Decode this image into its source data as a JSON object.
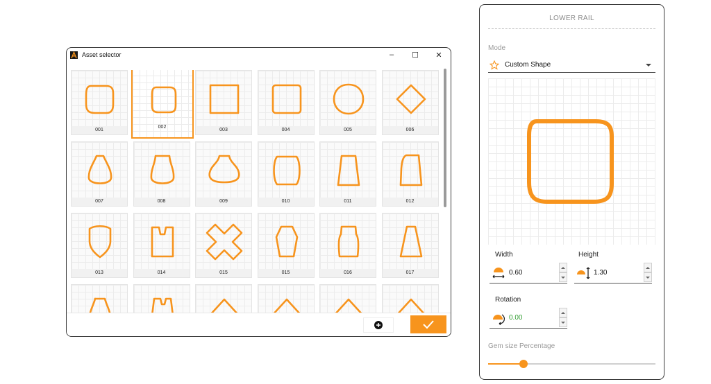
{
  "colors": {
    "accent": "#f7941d",
    "value_green": "#2e9b2e"
  },
  "asset_selector": {
    "title": "Asset selector",
    "window_controls": {
      "minimize": "–",
      "maximize": "☐",
      "close": "✕"
    },
    "selected_index": 1,
    "assets": [
      {
        "label": "001",
        "shape": "rounded-square-soft"
      },
      {
        "label": "002",
        "shape": "rounded-square"
      },
      {
        "label": "003",
        "shape": "square"
      },
      {
        "label": "004",
        "shape": "square-rounded-corners"
      },
      {
        "label": "005",
        "shape": "cushion-round"
      },
      {
        "label": "006",
        "shape": "diamond"
      },
      {
        "label": "007",
        "shape": "pear"
      },
      {
        "label": "008",
        "shape": "pear-flat-top"
      },
      {
        "label": "009",
        "shape": "bell"
      },
      {
        "label": "010",
        "shape": "barrel"
      },
      {
        "label": "011",
        "shape": "trapezoid"
      },
      {
        "label": "012",
        "shape": "tall-trapezoid-curved"
      },
      {
        "label": "013",
        "shape": "shield"
      },
      {
        "label": "014",
        "shape": "notched-rectangle"
      },
      {
        "label": "015",
        "shape": "cross"
      },
      {
        "label": "015",
        "shape": "hexagon-tall"
      },
      {
        "label": "016",
        "shape": "vase"
      },
      {
        "label": "017",
        "shape": "tall-trapezoid"
      },
      {
        "label": "",
        "shape": "partial-arch"
      },
      {
        "label": "",
        "shape": "partial-notch"
      },
      {
        "label": "",
        "shape": "partial-chevron"
      },
      {
        "label": "",
        "shape": "partial-chevron"
      },
      {
        "label": "",
        "shape": "partial-chevron"
      },
      {
        "label": "",
        "shape": "partial-chevron"
      }
    ],
    "footer": {
      "add_icon": "plus-circle-icon",
      "confirm_icon": "check-icon"
    }
  },
  "lower_rail": {
    "title": "LOWER RAIL",
    "mode_label": "Mode",
    "mode_value": "Custom Shape",
    "width_label": "Width",
    "width_value": "0.60",
    "height_label": "Height",
    "height_value": "1.30",
    "rotation_label": "Rotation",
    "rotation_value": "0.00",
    "gem_size_label": "Gem size Percentage",
    "gem_size_fraction": 0.21
  }
}
